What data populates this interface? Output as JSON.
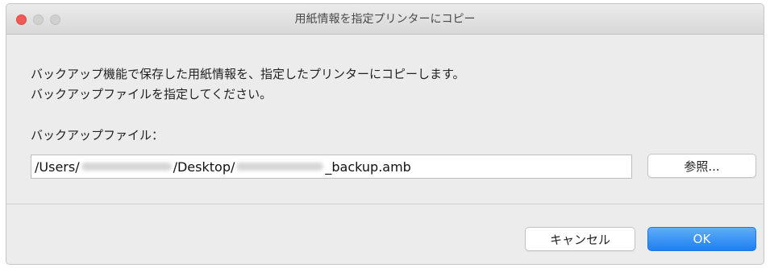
{
  "window": {
    "title": "用紙情報を指定プリンターにコピー"
  },
  "dialog": {
    "message_line1": "バックアップ機能で保存した用紙情報を、指定したプリンターにコピーします。",
    "message_line2": "バックアップファイルを指定してください。",
    "file_label": "バックアップファイル：",
    "path_prefix": "/Users/",
    "path_mid": "/Desktop/",
    "path_suffix": "_backup.amb",
    "browse_label": "参照..."
  },
  "footer": {
    "cancel_label": "キャンセル",
    "ok_label": "OK"
  },
  "colors": {
    "close_button": "#f25a55",
    "primary_button": "#1f7ff1"
  }
}
